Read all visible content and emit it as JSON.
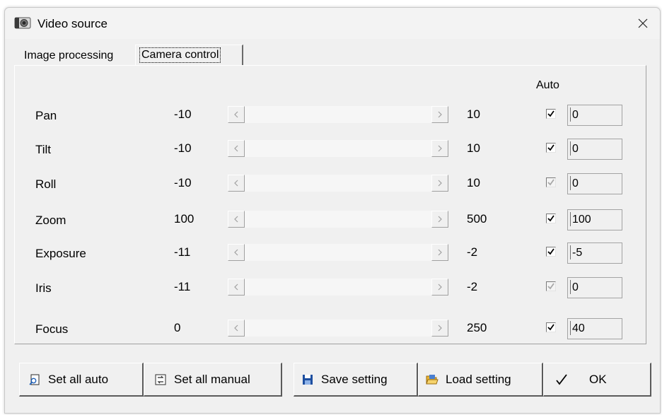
{
  "window": {
    "title": "Video source"
  },
  "tabs": [
    {
      "label": "Image processing"
    },
    {
      "label": "Camera control"
    }
  ],
  "auto_header": "Auto",
  "controls": [
    {
      "label": "Pan",
      "min": "-10",
      "max": "10",
      "auto_checked": true,
      "auto_enabled": true,
      "value": "0",
      "slider_position": 0
    },
    {
      "label": "Tilt",
      "min": "-10",
      "max": "10",
      "auto_checked": true,
      "auto_enabled": true,
      "value": "0",
      "slider_position": 0
    },
    {
      "label": "Roll",
      "min": "-10",
      "max": "10",
      "auto_checked": true,
      "auto_enabled": false,
      "value": "0",
      "slider_position": 0
    },
    {
      "label": "Zoom",
      "min": "100",
      "max": "500",
      "auto_checked": true,
      "auto_enabled": true,
      "value": "100",
      "slider_position": 0
    },
    {
      "label": "Exposure",
      "min": "-11",
      "max": "-2",
      "auto_checked": true,
      "auto_enabled": true,
      "value": "-5",
      "slider_position": 0
    },
    {
      "label": "Iris",
      "min": "-11",
      "max": "-2",
      "auto_checked": true,
      "auto_enabled": false,
      "value": "0",
      "slider_position": 0
    },
    {
      "label": "Focus",
      "min": "0",
      "max": "250",
      "auto_checked": true,
      "auto_enabled": true,
      "value": "40",
      "slider_position": 0
    }
  ],
  "buttons": {
    "set_all_auto": "Set all auto",
    "set_all_manual": "Set all manual",
    "save_setting": "Save setting",
    "load_setting": "Load setting",
    "ok": "OK"
  },
  "icons": {
    "title": "camera-icon",
    "close": "close-icon",
    "set_all_auto": "auto-icon",
    "set_all_manual": "manual-icon",
    "save_setting": "floppy-disk-icon",
    "load_setting": "open-folder-icon",
    "ok": "checkmark-icon"
  },
  "colors": {
    "dialog_background": "#f0f0f0",
    "save_icon": "#1e4fa0",
    "folder_icon": "#e8b230"
  }
}
